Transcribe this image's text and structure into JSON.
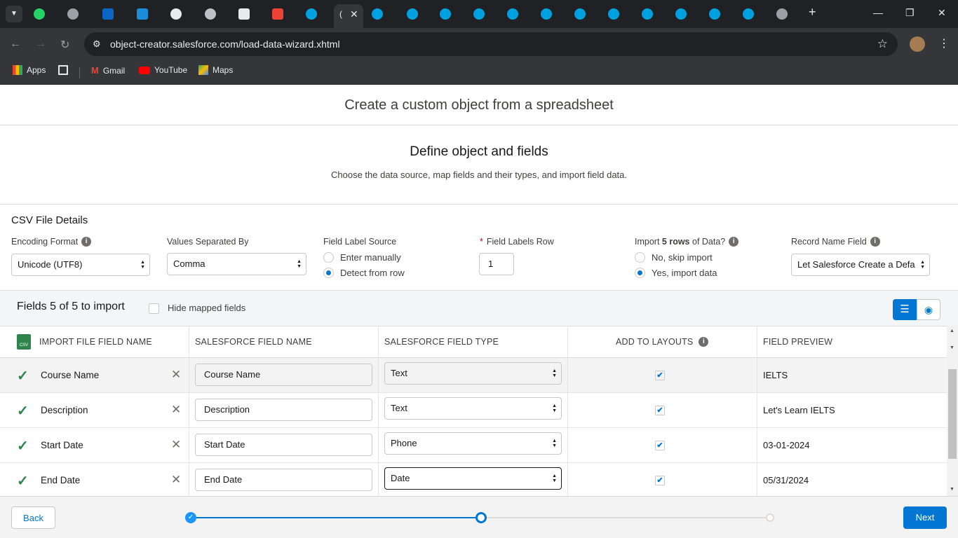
{
  "browser": {
    "url": "object-creator.salesforce.com/load-data-wizard.xhtml",
    "bookmarks": [
      "Apps",
      "Gmail",
      "YouTube",
      "Maps"
    ]
  },
  "page": {
    "title": "Create a custom object from a spreadsheet",
    "step_title": "Define object and fields",
    "step_subtitle": "Choose the data source, map fields and their types, and import field data."
  },
  "csv": {
    "heading": "CSV File Details",
    "encoding_label": "Encoding Format",
    "encoding_value": "Unicode (UTF8)",
    "separator_label": "Values Separated By",
    "separator_value": "Comma",
    "label_source_label": "Field Label Source",
    "label_source_options": [
      "Enter manually",
      "Detect from row"
    ],
    "labels_row_label": "Field Labels Row",
    "labels_row_value": "1",
    "import_label_pre": "Import ",
    "import_label_bold": "5 rows",
    "import_label_post": " of Data?",
    "import_options": [
      "No, skip import",
      "Yes, import data"
    ],
    "record_name_label": "Record Name Field",
    "record_name_value": "Let Salesforce Create a Defa"
  },
  "fields_bar": {
    "title": "Fields 5 of 5 to import",
    "hide_mapped": "Hide mapped fields"
  },
  "columns": [
    "IMPORT FILE FIELD NAME",
    "SALESFORCE FIELD NAME",
    "SALESFORCE FIELD TYPE",
    "ADD TO LAYOUTS",
    "FIELD PREVIEW"
  ],
  "rows": [
    {
      "import": "Course Name",
      "sf_name": "Course Name",
      "type": "Text",
      "preview": "IELTS"
    },
    {
      "import": "Description",
      "sf_name": "Description",
      "type": "Text",
      "preview": "Let's Learn IELTS"
    },
    {
      "import": "Start Date",
      "sf_name": "Start Date",
      "type": "Phone",
      "preview": "03-01-2024"
    },
    {
      "import": "End Date",
      "sf_name": "End Date",
      "type": "Date",
      "preview": "05/31/2024"
    }
  ],
  "footer": {
    "back": "Back",
    "next": "Next"
  },
  "colors": {
    "brand": "#0176d3",
    "success": "#2e844a"
  }
}
